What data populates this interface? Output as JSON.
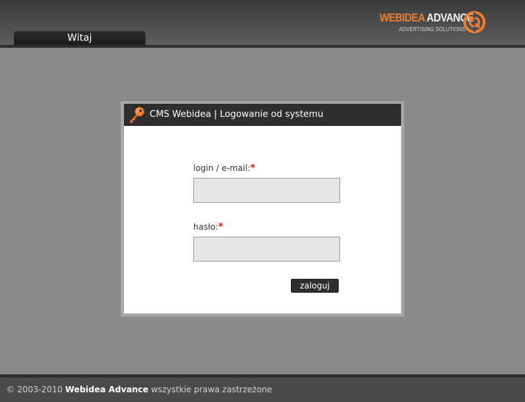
{
  "header": {
    "tab_label": "Witaj",
    "logo": {
      "word1": "WEBIDEA",
      "word2": "ADVANCE",
      "tagline": "ADVERTISING SOLUTIONS",
      "accent_color": "#ef7d2d"
    }
  },
  "dialog": {
    "title": "CMS Webidea | Logowanie od systemu",
    "icon": "key-icon",
    "login_label": "login / e-mail:",
    "password_label": "hasło:",
    "required_marker": "*",
    "login_value": "",
    "password_value": "",
    "submit_label": "zaloguj"
  },
  "footer": {
    "copyright": "© 2003-2010",
    "company": "Webidea Advance",
    "rights": "wszystkie prawa zastrzeżone"
  }
}
